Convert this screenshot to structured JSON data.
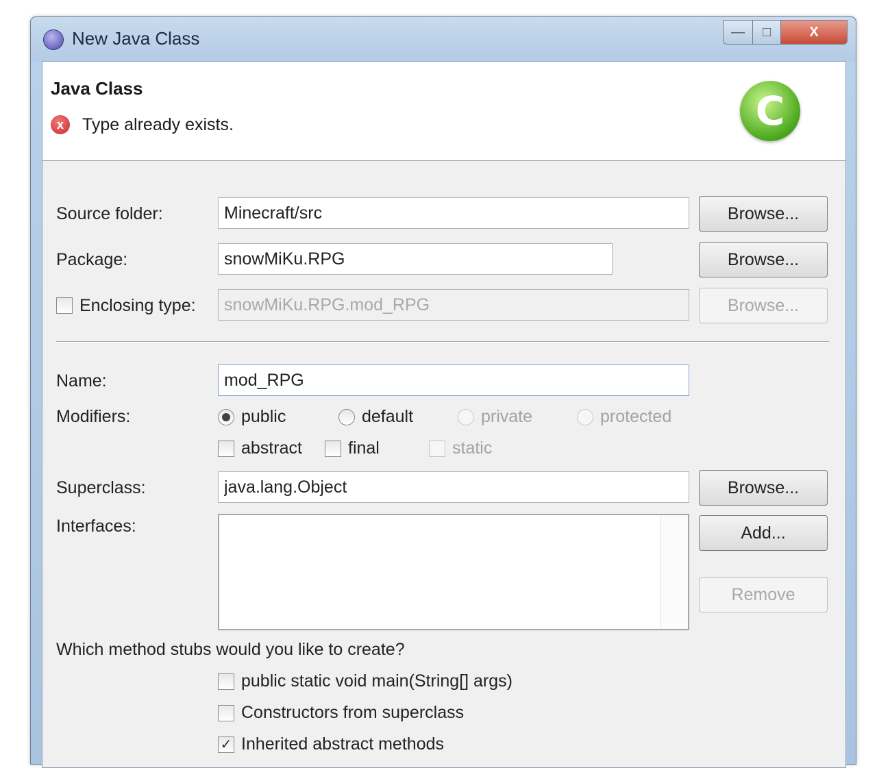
{
  "window": {
    "title": "New Java Class",
    "controls": {
      "minimize": "—",
      "maximize": "□",
      "close": "X"
    }
  },
  "header": {
    "title": "Java Class",
    "message": "Type already exists.",
    "error_icon": "x",
    "wizard_icon": "C"
  },
  "form": {
    "source_folder": {
      "label": "Source folder:",
      "value": "Minecraft/src",
      "button": "Browse..."
    },
    "package": {
      "label": "Package:",
      "value": "snowMiKu.RPG",
      "button": "Browse..."
    },
    "enclosing_type": {
      "label": "Enclosing type:",
      "value": "snowMiKu.RPG.mod_RPG",
      "button": "Browse...",
      "checked": false
    },
    "name": {
      "label": "Name:",
      "value": "mod_RPG"
    },
    "modifiers": {
      "label": "Modifiers:",
      "access": [
        {
          "label": "public",
          "selected": true,
          "enabled": true
        },
        {
          "label": "default",
          "selected": false,
          "enabled": true
        },
        {
          "label": "private",
          "selected": false,
          "enabled": false
        },
        {
          "label": "protected",
          "selected": false,
          "enabled": false
        }
      ],
      "flags": [
        {
          "label": "abstract",
          "checked": false,
          "enabled": true
        },
        {
          "label": "final",
          "checked": false,
          "enabled": true
        },
        {
          "label": "static",
          "checked": false,
          "enabled": false
        }
      ]
    },
    "superclass": {
      "label": "Superclass:",
      "value": "java.lang.Object",
      "button": "Browse..."
    },
    "interfaces": {
      "label": "Interfaces:",
      "add_button": "Add...",
      "remove_button": "Remove",
      "items": []
    }
  },
  "stubs": {
    "question": "Which method stubs would you like to create?",
    "options": [
      {
        "label": "public static void main(String[] args)",
        "checked": false
      },
      {
        "label": "Constructors from superclass",
        "checked": false
      },
      {
        "label": "Inherited abstract methods",
        "checked": true
      }
    ]
  }
}
